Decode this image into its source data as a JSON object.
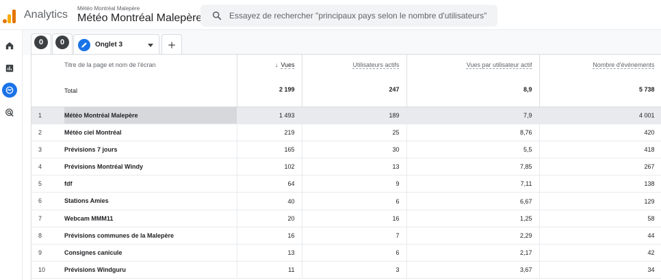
{
  "header": {
    "app_name": "Analytics",
    "property_small": "Météo Montréal Malepère",
    "property_name": "Météo Montréal Malepère",
    "search_placeholder": "Essayez de rechercher \"principaux pays selon le nombre d'utilisateurs\""
  },
  "rail": {
    "items": [
      "home-icon",
      "reports-icon",
      "explore-icon",
      "advertising-icon"
    ],
    "active": "explore-icon"
  },
  "tabs": {
    "segment_1": "0",
    "segment_2": "0",
    "active_tab": "Onglet 3",
    "add_label": "+"
  },
  "table": {
    "columns": {
      "dimension": "Titre de la page et nom de l'écran",
      "vues": "Vues",
      "utilisateurs": "Utilisateurs actifs",
      "vues_par_utilisateur": "Vues par utilisateur actif",
      "evenements": "Nombre d'événements"
    },
    "totals": {
      "label": "Total",
      "vues": "2 199",
      "utilisateurs": "247",
      "vues_par_utilisateur": "8,9",
      "evenements": "5 738"
    },
    "rows": [
      {
        "idx": "1",
        "name": "Météo Montréal Malepère",
        "vues": "1 493",
        "users": "189",
        "ratio": "7,9",
        "events": "4 001"
      },
      {
        "idx": "2",
        "name": "Météo ciel Montréal",
        "vues": "219",
        "users": "25",
        "ratio": "8,76",
        "events": "420"
      },
      {
        "idx": "3",
        "name": "Prévisions 7 jours",
        "vues": "165",
        "users": "30",
        "ratio": "5,5",
        "events": "418"
      },
      {
        "idx": "4",
        "name": "Prévisions Montréal Windy",
        "vues": "102",
        "users": "13",
        "ratio": "7,85",
        "events": "267"
      },
      {
        "idx": "5",
        "name": "fdf",
        "vues": "64",
        "users": "9",
        "ratio": "7,11",
        "events": "138"
      },
      {
        "idx": "6",
        "name": "Stations Amies",
        "vues": "40",
        "users": "6",
        "ratio": "6,67",
        "events": "129"
      },
      {
        "idx": "7",
        "name": "Webcam MMM11",
        "vues": "20",
        "users": "16",
        "ratio": "1,25",
        "events": "58"
      },
      {
        "idx": "8",
        "name": "Prévisions communes de la Malepère",
        "vues": "16",
        "users": "7",
        "ratio": "2,29",
        "events": "44"
      },
      {
        "idx": "9",
        "name": "Consignes canicule",
        "vues": "13",
        "users": "6",
        "ratio": "2,17",
        "events": "42"
      },
      {
        "idx": "10",
        "name": "Prévisions Windguru",
        "vues": "11",
        "users": "3",
        "ratio": "3,67",
        "events": "34"
      }
    ]
  },
  "colors": {
    "accent": "#1a73e8",
    "logo_orange": "#e37400",
    "logo_yellow": "#f9ab00",
    "selected_row": "#e8eaed"
  }
}
